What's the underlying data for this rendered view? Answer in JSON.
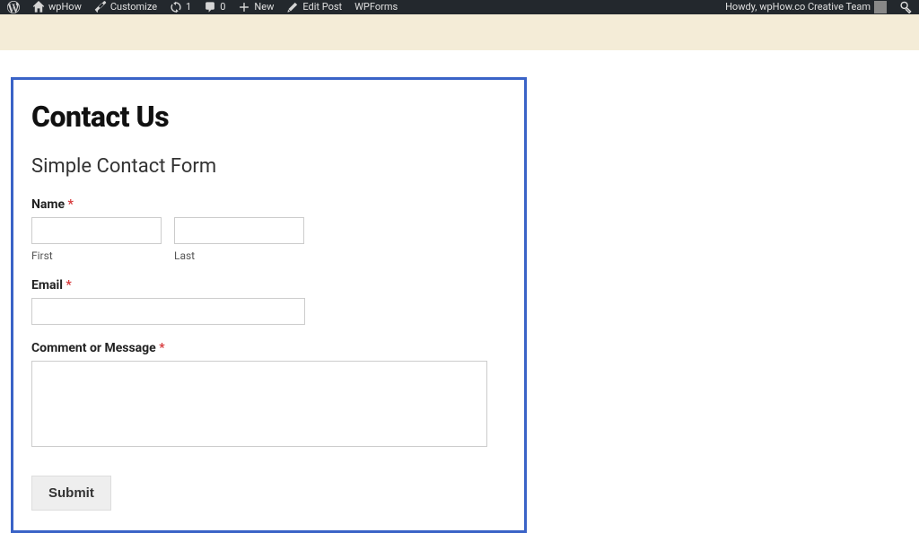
{
  "adminbar": {
    "site_name": "wpHow",
    "customize": "Customize",
    "updates_count": "1",
    "comments_count": "0",
    "new_label": "New",
    "edit_post": "Edit Post",
    "wpforms": "WPForms",
    "howdy": "Howdy, wpHow.co Creative Team"
  },
  "page": {
    "title": "Contact Us",
    "form_title": "Simple Contact Form",
    "fields": {
      "name_label": "Name",
      "first_sublabel": "First",
      "last_sublabel": "Last",
      "email_label": "Email",
      "message_label": "Comment or Message",
      "required_mark": "*"
    },
    "submit_label": "Submit"
  }
}
